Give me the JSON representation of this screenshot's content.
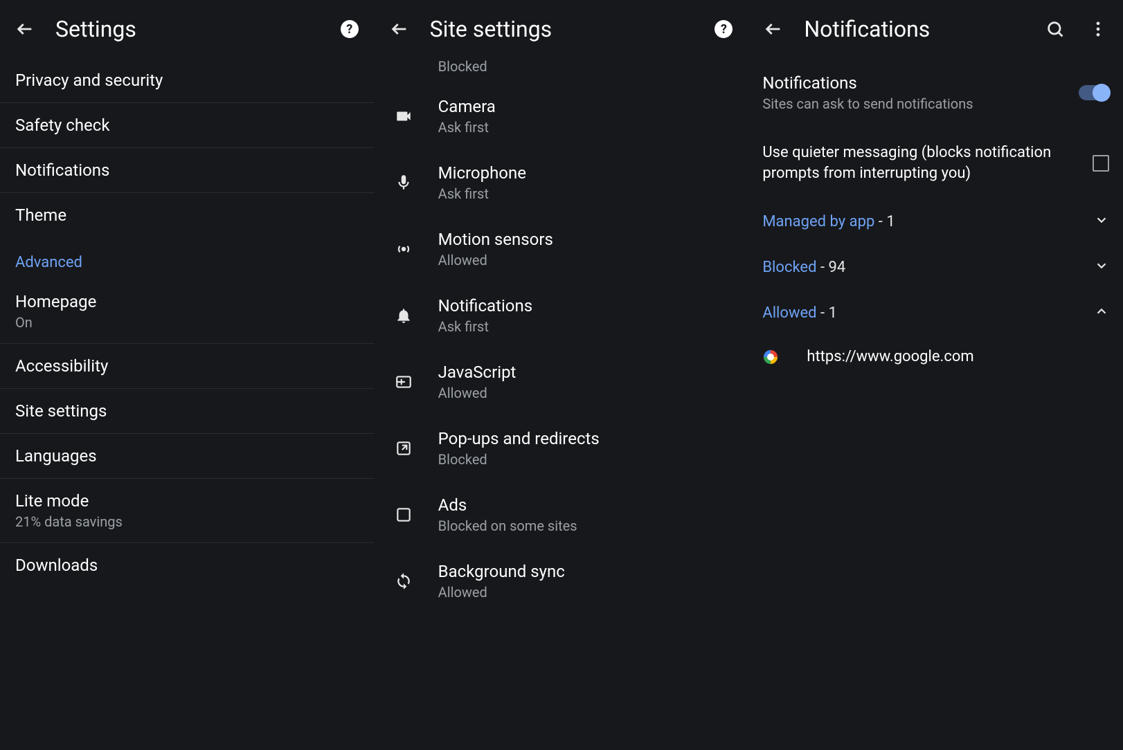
{
  "panel1": {
    "title": "Settings",
    "items": [
      {
        "label": "Privacy and security"
      },
      {
        "label": "Safety check"
      },
      {
        "label": "Notifications"
      },
      {
        "label": "Theme"
      }
    ],
    "section_label": "Advanced",
    "adv_items": [
      {
        "label": "Homepage",
        "sub": "On"
      },
      {
        "label": "Accessibility"
      },
      {
        "label": "Site settings"
      },
      {
        "label": "Languages"
      },
      {
        "label": "Lite mode",
        "sub": "21% data savings"
      },
      {
        "label": "Downloads"
      }
    ]
  },
  "panel2": {
    "title": "Site settings",
    "partial_top_sub": "Blocked",
    "items": [
      {
        "icon": "camera",
        "label": "Camera",
        "sub": "Ask first"
      },
      {
        "icon": "mic",
        "label": "Microphone",
        "sub": "Ask first"
      },
      {
        "icon": "motion",
        "label": "Motion sensors",
        "sub": "Allowed"
      },
      {
        "icon": "bell",
        "label": "Notifications",
        "sub": "Ask first"
      },
      {
        "icon": "js",
        "label": "JavaScript",
        "sub": "Allowed"
      },
      {
        "icon": "popup",
        "label": "Pop-ups and redirects",
        "sub": "Blocked"
      },
      {
        "icon": "ads",
        "label": "Ads",
        "sub": "Blocked on some sites"
      },
      {
        "icon": "sync",
        "label": "Background sync",
        "sub": "Allowed"
      }
    ]
  },
  "panel3": {
    "title": "Notifications",
    "master": {
      "label": "Notifications",
      "sub": "Sites can ask to send notifications"
    },
    "quieter_label": "Use quieter messaging (blocks notification prompts from interrupting you)",
    "groups": [
      {
        "name": "Managed by app",
        "count": "1",
        "expanded": false
      },
      {
        "name": "Blocked",
        "count": "94",
        "expanded": false
      },
      {
        "name": "Allowed",
        "count": "1",
        "expanded": true
      }
    ],
    "allowed_site": "https://www.google.com"
  }
}
